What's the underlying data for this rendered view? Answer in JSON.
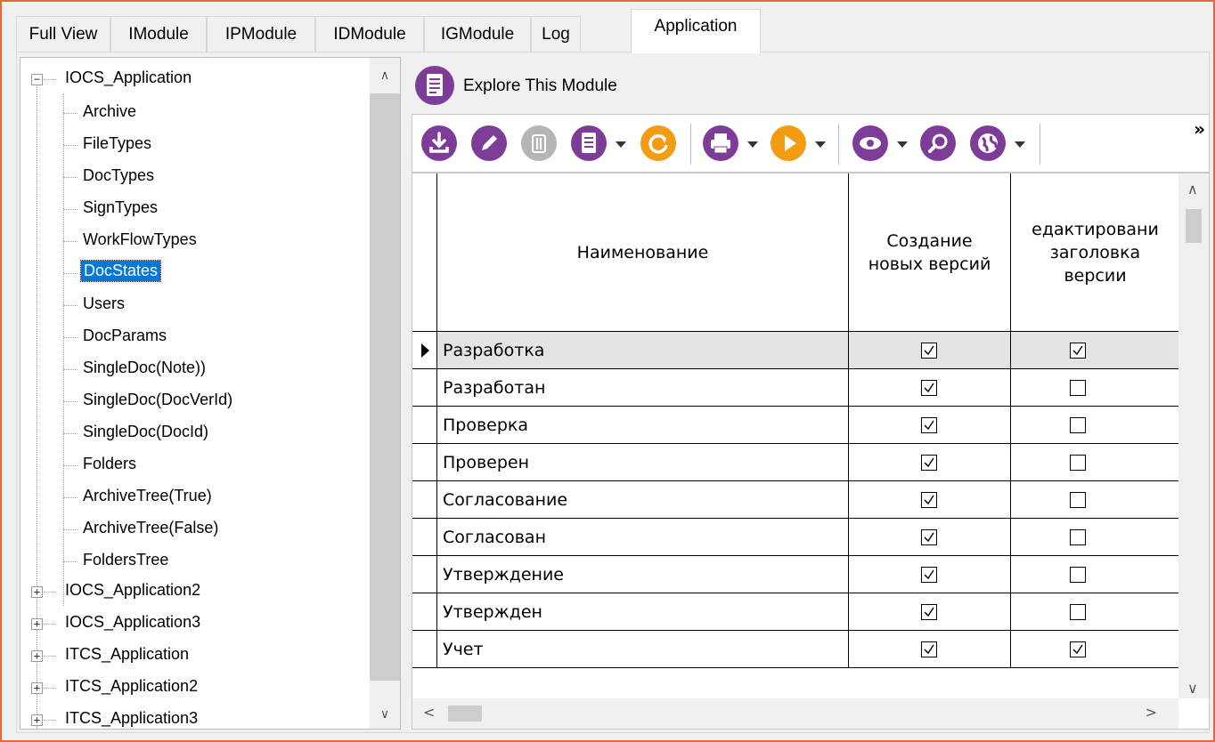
{
  "tabs": [
    "Full View",
    "IModule",
    "IPModule",
    "IDModule",
    "IGModule",
    "Log",
    "Application"
  ],
  "active_tab": "Application",
  "tree": {
    "root": "IOCS_Application",
    "children": [
      "Archive",
      "FileTypes",
      "DocTypes",
      "SignTypes",
      "WorkFlowTypes",
      "DocStates",
      "Users",
      "DocParams",
      "SingleDoc(Note))",
      "SingleDoc(DocVerId)",
      "SingleDoc(DocId)",
      "Folders",
      "ArchiveTree(True)",
      "ArchiveTree(False)",
      "FoldersTree"
    ],
    "selected": "DocStates",
    "collapsed_roots": [
      "IOCS_Application2",
      "IOCS_Application3",
      "ITCS_Application",
      "ITCS_Application2",
      "ITCS_Application3"
    ]
  },
  "explore": {
    "label": "Explore This Module",
    "icon": "document-icon"
  },
  "toolbar": {
    "buttons": [
      "download-icon",
      "edit-icon",
      "delete-icon",
      "document-icon",
      "refresh-icon",
      "print-icon",
      "play-icon",
      "eye-icon",
      "search-icon",
      "globe-icon"
    ],
    "more": "»",
    "colors": {
      "purple": "#7d3c98",
      "orange": "#f39c12",
      "gray": "#b0b0b0"
    }
  },
  "grid": {
    "columns": [
      "Наименование",
      "Создание новых версий",
      "едактировани заголовка версии"
    ],
    "rows": [
      {
        "name": "Разработка",
        "create": true,
        "edit": true,
        "current": true
      },
      {
        "name": "Разработан",
        "create": true,
        "edit": false
      },
      {
        "name": "Проверка",
        "create": true,
        "edit": false
      },
      {
        "name": "Проверен",
        "create": true,
        "edit": false
      },
      {
        "name": "Согласование",
        "create": true,
        "edit": false
      },
      {
        "name": "Согласован",
        "create": true,
        "edit": false
      },
      {
        "name": "Утверждение",
        "create": true,
        "edit": false
      },
      {
        "name": "Утвержден",
        "create": true,
        "edit": false
      },
      {
        "name": "Учет",
        "create": true,
        "edit": true
      }
    ]
  }
}
